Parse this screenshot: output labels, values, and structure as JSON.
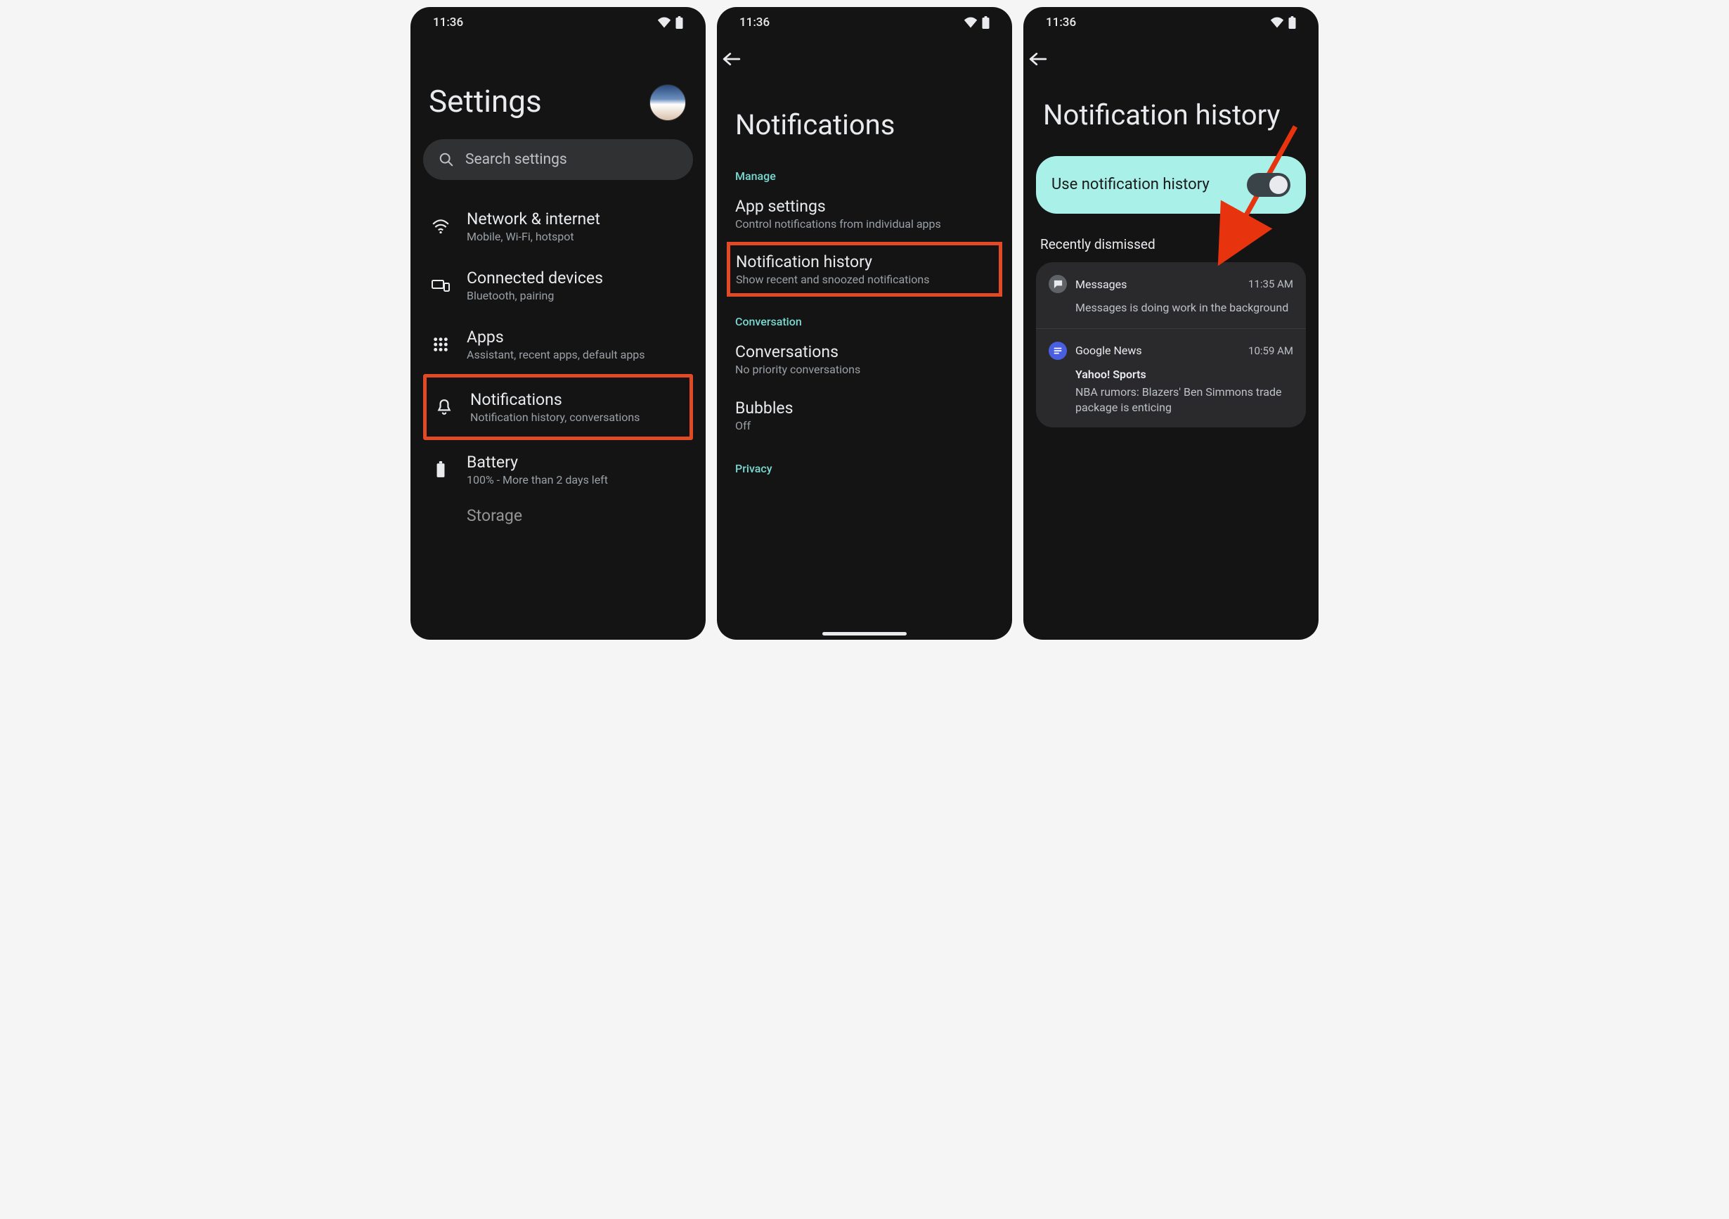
{
  "status": {
    "time": "11:36"
  },
  "screen1": {
    "title": "Settings",
    "search_placeholder": "Search settings",
    "rows": [
      {
        "title": "Network & internet",
        "sub": "Mobile, Wi-Fi, hotspot"
      },
      {
        "title": "Connected devices",
        "sub": "Bluetooth, pairing"
      },
      {
        "title": "Apps",
        "sub": "Assistant, recent apps, default apps"
      },
      {
        "title": "Notifications",
        "sub": "Notification history, conversations"
      },
      {
        "title": "Battery",
        "sub": "100% - More than 2 days left"
      }
    ],
    "cutoff": "Storage"
  },
  "screen2": {
    "title": "Notifications",
    "sections": {
      "manage": "Manage",
      "conversation": "Conversation",
      "privacy": "Privacy"
    },
    "items": {
      "app_settings": {
        "title": "App settings",
        "sub": "Control notifications from individual apps"
      },
      "notification_history": {
        "title": "Notification history",
        "sub": "Show recent and snoozed notifications"
      },
      "conversations": {
        "title": "Conversations",
        "sub": "No priority conversations"
      },
      "bubbles": {
        "title": "Bubbles",
        "sub": "Off"
      }
    }
  },
  "screen3": {
    "title": "Notification history",
    "toggle_label": "Use notification history",
    "dismissed_label": "Recently dismissed",
    "notifs": [
      {
        "app": "Messages",
        "time": "11:35 AM",
        "title": "",
        "body": "Messages is doing work in the background"
      },
      {
        "app": "Google News",
        "time": "10:59 AM",
        "title": "Yahoo! Sports",
        "body": "NBA rumors: Blazers' Ben Simmons trade package is enticing"
      }
    ]
  }
}
